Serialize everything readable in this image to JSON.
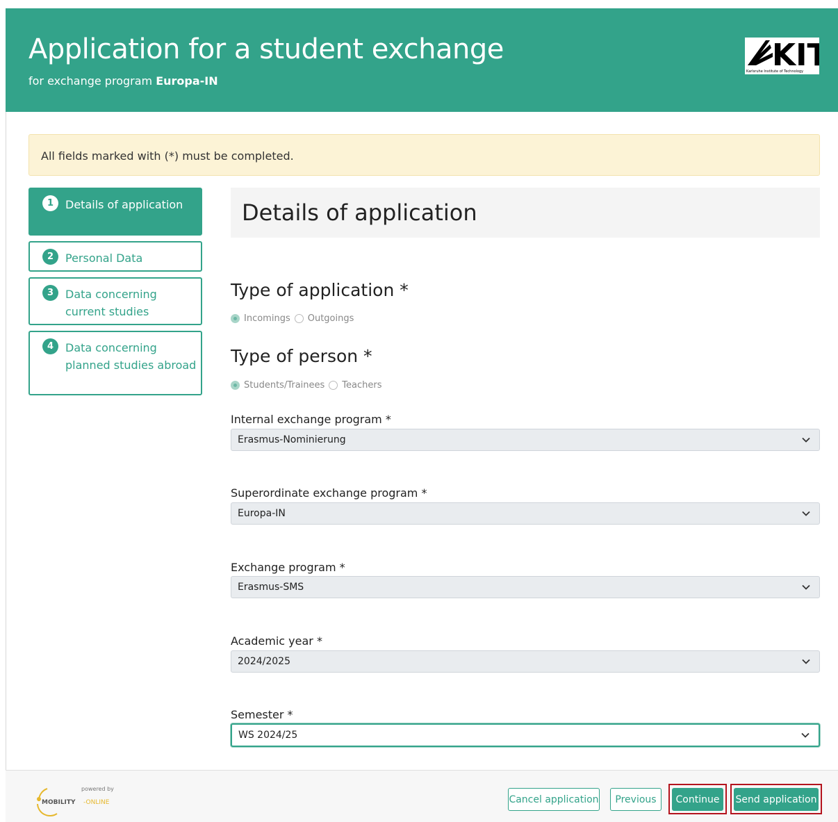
{
  "header": {
    "title": "Application for a student exchange",
    "subtitle_prefix": "for exchange program ",
    "subtitle_program": "Europa-IN",
    "logo_text": "KIT",
    "logo_tagline": "Karlsruhe Institute of Technology"
  },
  "alert": {
    "text": "All fields marked with (*) must be completed."
  },
  "steps": [
    {
      "num": "1",
      "label": "Details of application",
      "active": true
    },
    {
      "num": "2",
      "label": "Personal Data",
      "active": false
    },
    {
      "num": "3",
      "label": "Data concerning current studies",
      "active": false
    },
    {
      "num": "4",
      "label": "Data concerning planned studies abroad",
      "active": false
    }
  ],
  "section": {
    "title": "Details of application"
  },
  "type_of_application": {
    "title": "Type of application *",
    "options": [
      "Incomings",
      "Outgoings"
    ],
    "selected": "Incomings"
  },
  "type_of_person": {
    "title": "Type of person *",
    "options": [
      "Students/Trainees",
      "Teachers"
    ],
    "selected": "Students/Trainees"
  },
  "fields": [
    {
      "label": "Internal exchange program *",
      "value": "Erasmus-Nominierung"
    },
    {
      "label": "Superordinate exchange program *",
      "value": "Europa-IN"
    },
    {
      "label": "Exchange program *",
      "value": "Erasmus-SMS"
    },
    {
      "label": "Academic year *",
      "value": "2024/2025"
    },
    {
      "label": "Semester *",
      "value": "WS 2024/25"
    }
  ],
  "footer": {
    "powered_by": "powered by",
    "logo_text_a": "MOBILITY",
    "logo_text_b": "-ONLINE",
    "buttons": {
      "cancel": "Cancel application",
      "previous": "Previous",
      "continue": "Continue",
      "send": "Send application"
    }
  },
  "colors": {
    "brand": "#33a38a",
    "alert_bg": "#fcf3d6",
    "highlight_outline": "#b4141e"
  }
}
